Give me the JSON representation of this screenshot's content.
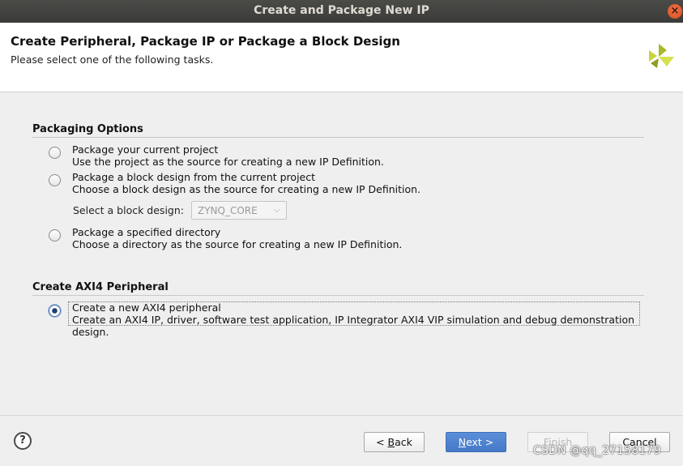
{
  "window": {
    "title": "Create and Package New IP",
    "close_glyph": "×"
  },
  "header": {
    "title": "Create Peripheral, Package IP or Package a Block Design",
    "subtitle": "Please select one of the following tasks.",
    "logo_icon": "xilinx-logo-icon",
    "logo_color": "#b8c832"
  },
  "packaging": {
    "title": "Packaging Options",
    "options": [
      {
        "label": "Package your current project",
        "desc": "Use the project as the source for creating a new IP Definition.",
        "checked": false
      },
      {
        "label": "Package a block design from the current project",
        "desc": "Choose a block design as the source for creating a new IP Definition.",
        "checked": false
      },
      {
        "label": "Package a specified directory",
        "desc": "Choose a directory as the source for creating a new IP Definition.",
        "checked": false
      }
    ],
    "block_design_label": "Select a block design:",
    "block_design_value": "ZYNQ_CORE"
  },
  "axi": {
    "title": "Create AXI4 Peripheral",
    "option": {
      "label": "Create a new AXI4 peripheral",
      "desc_line1": "Create an AXI4 IP, driver, software test application, IP Integrator AXI4 VIP simulation and debug demonstration",
      "desc_line2": "design.",
      "checked": true
    }
  },
  "footer": {
    "help": "?",
    "back": {
      "prefix": "< ",
      "mnemonic": "B",
      "rest": "ack"
    },
    "next": {
      "mnemonic": "N",
      "rest": "ext >"
    },
    "finish": "Finish",
    "cancel": "Cancel"
  },
  "watermark": "CSDN @qq_27158179",
  "colors": {
    "titlebar": "#3f3f3d",
    "primary_button": "#4f84d0",
    "radio_selected": "#1f3f73"
  }
}
